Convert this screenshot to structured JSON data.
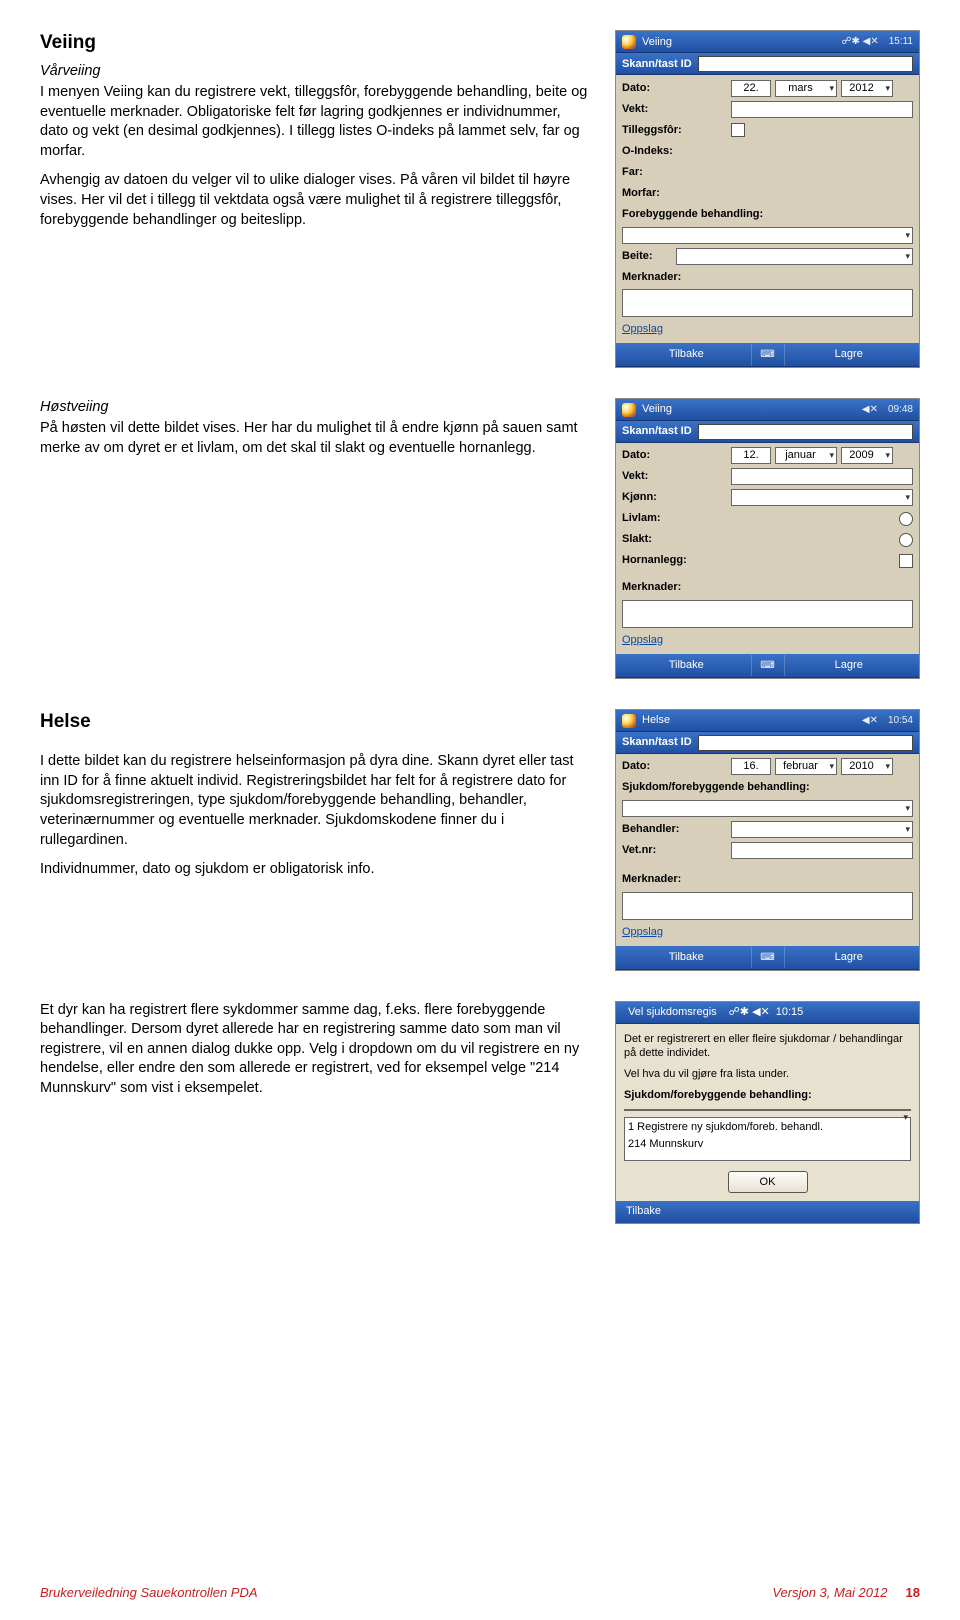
{
  "headings": {
    "veiing": "Veiing",
    "varveiing": "Vårveiing",
    "hostveiing": "Høstveiing",
    "helse": "Helse"
  },
  "paragraphs": {
    "var_p1": "I menyen Veiing kan du registrere vekt, tilleggsfôr, forebyggende behandling, beite og eventuelle merknader. Obligatoriske felt før lagring godkjennes er individnummer, dato og vekt (en desimal godkjennes). I tillegg listes O-indeks på lammet selv, far og morfar.",
    "var_p2": "Avhengig av datoen du velger vil to ulike dialoger vises. På våren vil bildet til høyre vises. Her vil det i tillegg til vektdata også være mulighet til å registrere tilleggsfôr, forebyggende behandlinger og beiteslipp.",
    "host_p1": "På høsten vil dette bildet vises. Her har du mulighet til å endre kjønn på sauen samt merke av om dyret er et livlam, om det skal til slakt og eventuelle hornanlegg.",
    "helse_p1": "I dette bildet kan du registrere helseinformasjon på dyra dine. Skann dyret eller tast inn ID for å finne aktuelt individ. Registreringsbildet har felt for å registrere dato for sjukdomsregistreringen, type sjukdom/forebyggende behandling, behandler, veterinærnummer og eventuelle merknader. Sjukdomskodene finner du i rullegardinen.",
    "helse_p2": "Individnummer, dato og sjukdom er obligatorisk info.",
    "helse_p3": "Et dyr kan ha registrert flere sykdommer samme dag, f.eks. flere forebyggende behandlinger. Dersom dyret allerede har en registrering samme dato som man vil registrere, vil en annen dialog dukke opp. Velg i dropdown om du vil registrere en ny hendelse, eller endre den som allerede er registrert, ved for eksempel velge \"214 Munnskurv\" som vist i eksempelet."
  },
  "pda_common": {
    "skann_label": "Skann/tast ID",
    "dato": "Dato:",
    "vekt": "Vekt:",
    "merknader": "Merknader:",
    "oppslag": "Oppslag",
    "tilbake": "Tilbake",
    "lagre": "Lagre",
    "kbd": "⌨"
  },
  "shot1": {
    "title": "Veiing",
    "time": "15:11",
    "signal": "☍✱ ◀✕",
    "day": "22.",
    "month": "mars",
    "year": "2012",
    "labels": {
      "tilleggsfor": "Tilleggsfôr:",
      "oindeks": "O-Indeks:",
      "far": "Far:",
      "morfar": "Morfar:",
      "foreb": "Forebyggende behandling:",
      "beite": "Beite:"
    }
  },
  "shot2": {
    "title": "Veiing",
    "time": "09:48",
    "signal": "◀✕",
    "day": "12.",
    "month": "januar",
    "year": "2009",
    "labels": {
      "kjonn": "Kjønn:",
      "livlam": "Livlam:",
      "slakt": "Slakt:",
      "horn": "Hornanlegg:"
    }
  },
  "shot3": {
    "title": "Helse",
    "time": "10:54",
    "signal": "◀✕",
    "day": "16.",
    "month": "februar",
    "year": "2010",
    "labels": {
      "sjuk": "Sjukdom/forebyggende behandling:",
      "behandler": "Behandler:",
      "vetnr": "Vet.nr:"
    }
  },
  "shot4": {
    "title": "Vel sjukdomsregis",
    "time": "10:15",
    "signal": "☍✱ ◀✕",
    "body_p1": "Det er registrerert en eller fleire sjukdomar / behandlingar på dette individet.",
    "body_p2": "Vel hva du vil gjøre fra lista under.",
    "label_sjuk": "Sjukdom/forebyggende behandling:",
    "list": [
      "1 Registrere ny sjukdom/foreb. behandl.",
      "214 Munnskurv"
    ],
    "ok": "OK",
    "tilbake": "Tilbake"
  },
  "footer": {
    "left": "Brukerveiledning Sauekontrollen PDA",
    "mid": "Versjon 3, Mai 2012",
    "num": "18"
  }
}
